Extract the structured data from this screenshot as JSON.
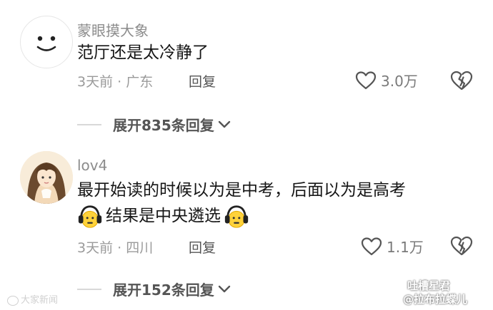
{
  "comments": [
    {
      "username": "蒙眼摸大象",
      "text_lines": [
        "范厅还是太冷静了"
      ],
      "time_location": "3天前 · 广东",
      "reply_label": "回复",
      "likes": "3.0万",
      "expand_label": "展开835条回复",
      "avatar": "smiley-face-avatar"
    },
    {
      "username": "lov4",
      "text_line1": "最开始读的时候以为是中考，后面以为是高考",
      "text_line2": "结果是中央遴选",
      "time_location": "3天前 · 四川",
      "reply_label": "回复",
      "likes": "1.1万",
      "expand_label": "展开152条回复",
      "avatar": "anime-girl-avatar",
      "emoji": "headphone-emoji"
    }
  ],
  "watermark": {
    "left": "大家新闻",
    "right_line1": "吐槽星君",
    "right_line2": "@拉布拉蝶儿"
  }
}
